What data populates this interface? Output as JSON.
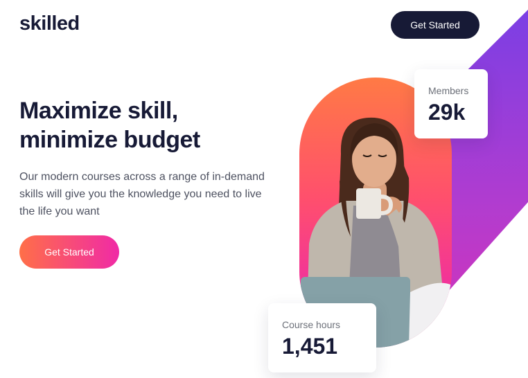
{
  "header": {
    "logo": "skilled",
    "cta_label": "Get Started"
  },
  "hero": {
    "headline_line1": "Maximize skill,",
    "headline_line2": "minimize budget",
    "description": "Our modern courses across a range of in-demand skills will give you the knowledge you need to live the life you want",
    "cta_label": "Get Started"
  },
  "stats": {
    "members": {
      "label": "Members",
      "value": "29k"
    },
    "course_hours": {
      "label": "Course hours",
      "value": "1,451"
    }
  },
  "colors": {
    "navy": "#171a36",
    "gradient_start": "#ff6f48",
    "gradient_end": "#f02aa6",
    "purple": "#7b3fe4"
  }
}
